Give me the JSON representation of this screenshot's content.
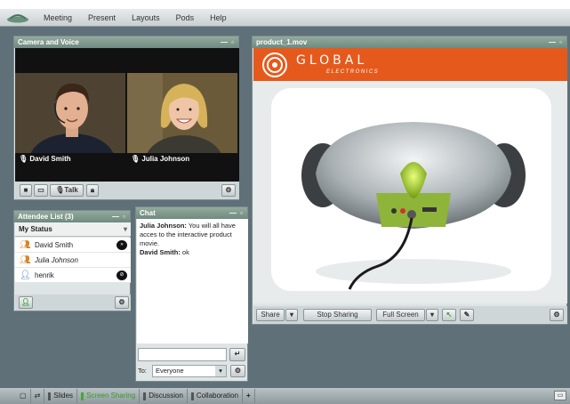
{
  "menu": [
    "Meeting",
    "Present",
    "Layouts",
    "Pods",
    "Help"
  ],
  "camera_pod": {
    "title": "Camera and Voice",
    "controls": "— ▫",
    "participants": [
      {
        "name": "David Smith"
      },
      {
        "name": "Julia Johnson"
      }
    ],
    "talk_label": "Talk"
  },
  "video_pod": {
    "title": "product_1.mov",
    "controls": "— ▫",
    "brand": "GLOBAL",
    "brand_sub": "ELECTRONICS",
    "share_label": "Share",
    "stop_sharing_label": "Stop Sharing",
    "full_screen_label": "Full Screen"
  },
  "attendee_pod": {
    "title": "Attendee List (3)",
    "controls": "— ▫",
    "my_status": "My Status",
    "attendees": [
      {
        "name": "David Smith",
        "italic": false,
        "status": "speech"
      },
      {
        "name": "Julia Johnson",
        "italic": true,
        "status": ""
      },
      {
        "name": "henrik",
        "italic": false,
        "status": "stop"
      }
    ]
  },
  "chat_pod": {
    "title": "Chat",
    "controls": "— ▫",
    "messages": [
      {
        "sender": "Julia Johnson:",
        "text": " You will all have acces to the interactive product movie."
      },
      {
        "sender": "David Smith:",
        "text": " ok"
      }
    ],
    "to_label": "To:",
    "recipient": "Everyone"
  },
  "tabs": [
    {
      "label": "Slides",
      "active": false
    },
    {
      "label": "Screen Sharing",
      "active": true
    },
    {
      "label": "Discussion",
      "active": false
    },
    {
      "label": "Collaboration",
      "active": false
    }
  ],
  "add_tab_label": "+",
  "colors": {
    "accent_orange": "#e55a1c",
    "pod_title": "#7f9a8d",
    "active_tab": "#3b9a2f"
  }
}
